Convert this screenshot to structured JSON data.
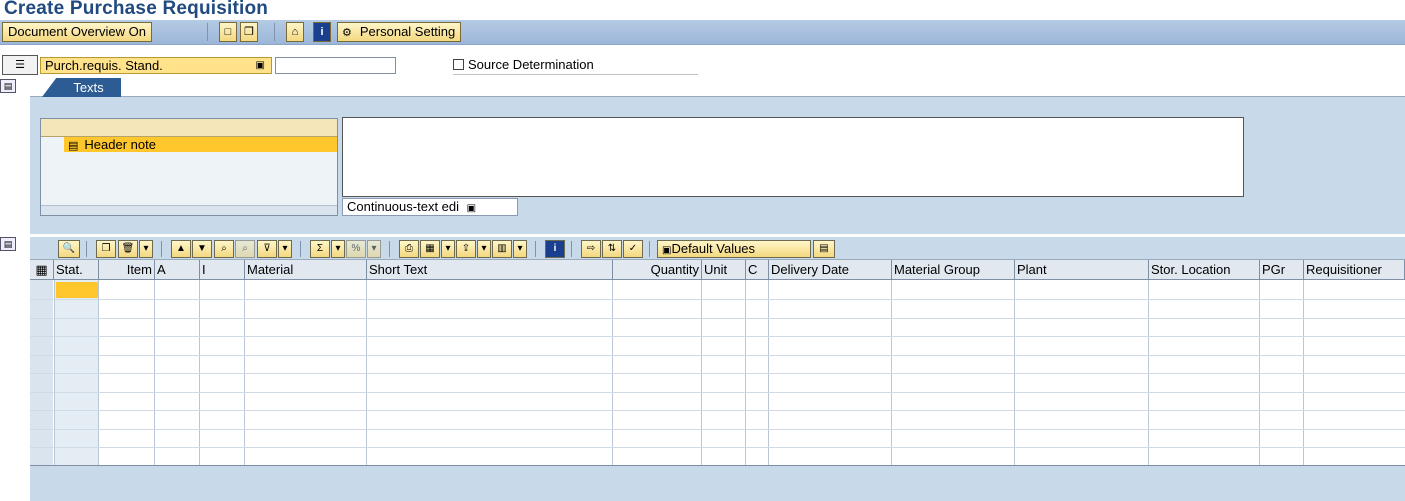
{
  "window": {
    "title": "Create Purchase Requisition"
  },
  "toolbar": {
    "document_overview": "Document Overview On",
    "personal_setting": "Personal Setting",
    "new_doc_glyph": "□",
    "copy_glyph": "❐",
    "hold_glyph": "⌂",
    "info_glyph": "i",
    "settings_glyph": "⚙"
  },
  "header": {
    "doc_type": "Purch.requis. Stand.",
    "doc_number": "",
    "source_determination": "Source Determination",
    "cart_glyph": "☰",
    "dropdown_glyph": "▣"
  },
  "texts_tab": {
    "tab_label": "Texts",
    "tree_items": [
      "Header note"
    ],
    "editor_value": "",
    "editor_mode": "Continuous-text edi",
    "doc_glyph": "▤"
  },
  "items_toolbar": {
    "default_values": "Default Values"
  },
  "items_table": {
    "columns": [
      "Stat.",
      "Item",
      "A",
      "I",
      "Material",
      "Short Text",
      "Quantity",
      "Unit",
      "C",
      "Delivery Date",
      "Material Group",
      "Plant",
      "Stor. Location",
      "PGr",
      "Requisitioner"
    ]
  },
  "colors": {
    "title": "#204a80",
    "toolbar": "#aac2e0",
    "panel": "#c8d9ea",
    "highlight": "#ffc72c",
    "tab": "#2c5c93"
  }
}
